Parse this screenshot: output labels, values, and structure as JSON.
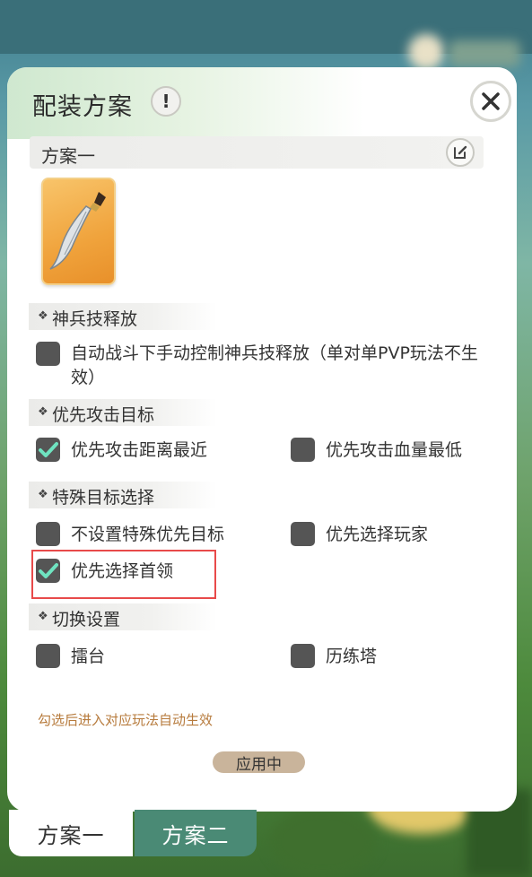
{
  "panel": {
    "title": "配装方案",
    "info_label": "!",
    "scheme_name": "方案一"
  },
  "sections": {
    "skill": {
      "title": "神兵技释放",
      "options": [
        {
          "label": "自动战斗下手动控制神兵技释放（单对单PVP玩法不生效）",
          "checked": false
        }
      ]
    },
    "priority_target": {
      "title": "优先攻击目标",
      "options": [
        {
          "label": "优先攻击距离最近",
          "checked": true
        },
        {
          "label": "优先攻击血量最低",
          "checked": false
        }
      ]
    },
    "special_target": {
      "title": "特殊目标选择",
      "options": [
        {
          "label": "不设置特殊优先目标",
          "checked": false
        },
        {
          "label": "优先选择玩家",
          "checked": false
        },
        {
          "label": "优先选择首领",
          "checked": true
        }
      ]
    },
    "switch_settings": {
      "title": "切换设置",
      "options": [
        {
          "label": "擂台",
          "checked": false
        },
        {
          "label": "历练塔",
          "checked": false
        }
      ]
    }
  },
  "hint": "勾选后进入对应玩法自动生效",
  "status": "应用中",
  "tabs": [
    {
      "label": "方案一",
      "active": true
    },
    {
      "label": "方案二",
      "active": false
    }
  ],
  "colors": {
    "checkbox": "#555555",
    "check_mark": "#6fe3c0",
    "highlight_border": "#e84a4a",
    "active_tab": "#ffffff",
    "inactive_tab": "#4a8a75",
    "hint_text": "#b77b3d"
  }
}
